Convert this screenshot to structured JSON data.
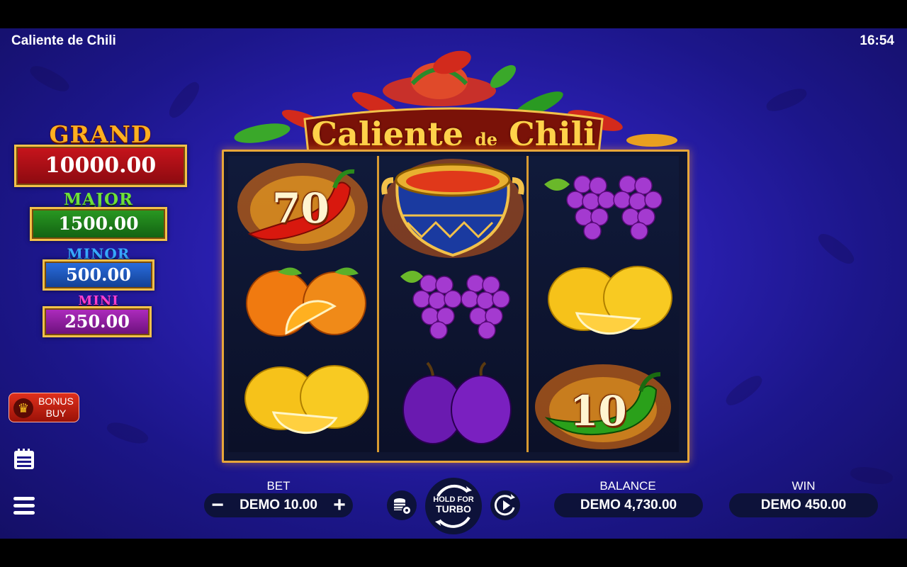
{
  "header": {
    "title": "Caliente de Chili",
    "time": "16:54"
  },
  "logo": {
    "word1": "Caliente",
    "word2": "de",
    "word3": "Chili"
  },
  "jackpots": [
    {
      "label": "GRAND",
      "value": "10000.00",
      "color": "#c8141c"
    },
    {
      "label": "MAJOR",
      "value": "1500.00",
      "color": "#2a9a22"
    },
    {
      "label": "MINOR",
      "value": "500.00",
      "color": "#2a6ee0"
    },
    {
      "label": "MINI",
      "value": "250.00",
      "color": "#b02cc0"
    }
  ],
  "bonus_buy": {
    "line1": "BONUS",
    "line2": "BUY",
    "icon": "crown-icon"
  },
  "reels": [
    [
      "chili-red-70",
      "orange",
      "lemon"
    ],
    [
      "pot-bonus",
      "grapes",
      "plum"
    ],
    [
      "grapes",
      "lemon",
      "chili-green-10"
    ]
  ],
  "symbol_values": {
    "red_chili": "70",
    "green_chili": "10"
  },
  "controls": {
    "bet_label": "BET",
    "bet_value": "DEMO 10.00",
    "minus": "−",
    "plus": "+",
    "spin_line1": "HOLD FOR",
    "spin_line2": "TURBO",
    "balance_label": "BALANCE",
    "balance_value": "DEMO 4,730.00",
    "win_label": "WIN",
    "win_value": "DEMO 450.00"
  },
  "icons": [
    "paytable-icon",
    "menu-icon",
    "coin-settings-icon",
    "autoplay-icon",
    "spin-arrows-icon"
  ]
}
